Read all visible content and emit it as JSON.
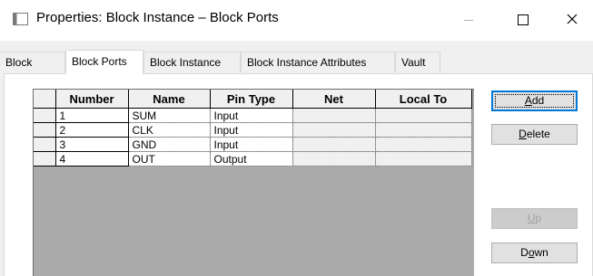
{
  "window": {
    "title": "Properties: Block Instance – Block Ports",
    "minimize_glyph": "—",
    "close_glyph": "✕"
  },
  "tabs": [
    {
      "label": "Block",
      "active": false
    },
    {
      "label": "Block Ports",
      "active": true
    },
    {
      "label": "Block Instance",
      "active": false
    },
    {
      "label": "Block Instance Attributes",
      "active": false
    },
    {
      "label": "Vault",
      "active": false
    }
  ],
  "grid": {
    "columns": [
      "Number",
      "Name",
      "Pin Type",
      "Net",
      "Local To"
    ],
    "rows": [
      {
        "number": "1",
        "name": "SUM",
        "pin_type": "Input",
        "net": "",
        "local_to": ""
      },
      {
        "number": "2",
        "name": "CLK",
        "pin_type": "Input",
        "net": "",
        "local_to": ""
      },
      {
        "number": "3",
        "name": "GND",
        "pin_type": "Input",
        "net": "",
        "local_to": ""
      },
      {
        "number": "4",
        "name": "OUT",
        "pin_type": "Output",
        "net": "",
        "local_to": ""
      }
    ]
  },
  "buttons": {
    "add": {
      "pre": "",
      "accel": "A",
      "post": "dd"
    },
    "delete": {
      "pre": "",
      "accel": "D",
      "post": "elete"
    },
    "up": {
      "pre": "",
      "accel": "U",
      "post": "p"
    },
    "down": {
      "pre": "D",
      "accel": "o",
      "post": "wn"
    }
  },
  "colors": {
    "accent": "#0078d7",
    "grid_background": "#ababab",
    "panel": "#ffffff",
    "chrome": "#f0f0f0"
  }
}
